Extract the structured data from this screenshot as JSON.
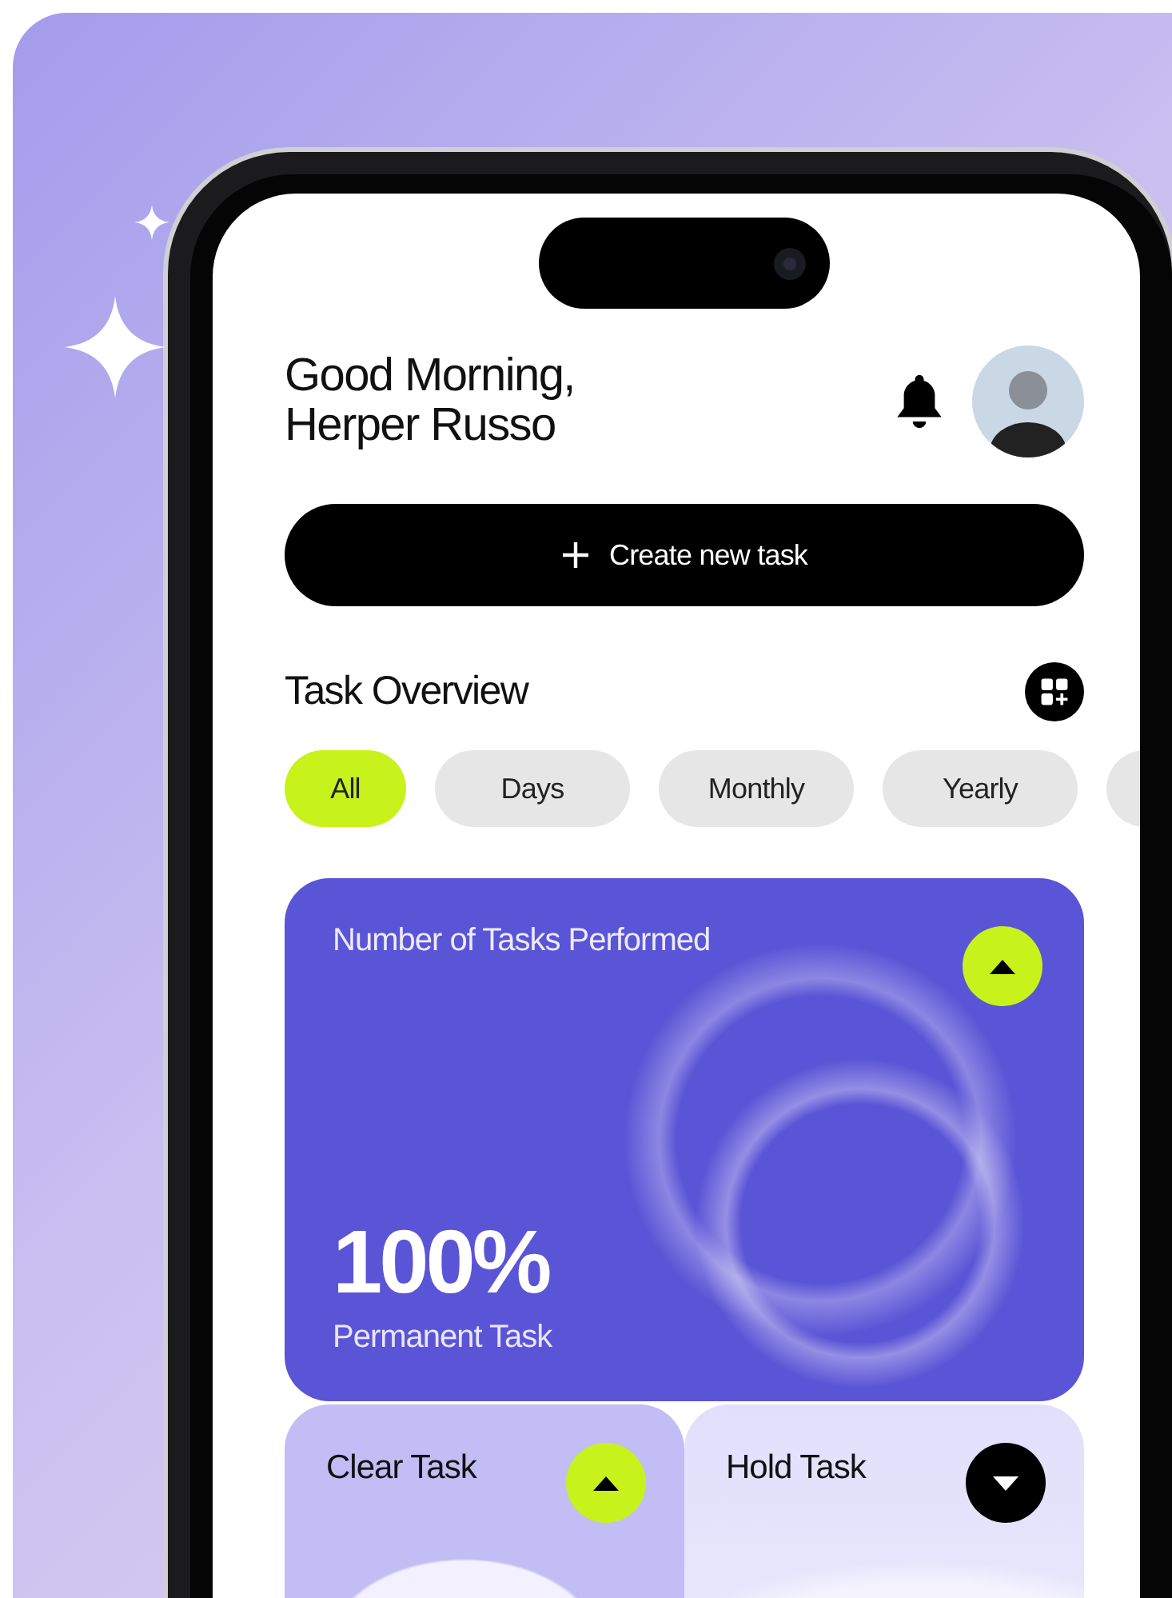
{
  "greeting": {
    "line_1": "Good Morning,",
    "line_2": "Herper Russo"
  },
  "create_button": {
    "label": "Create new task"
  },
  "overview": {
    "title": "Task Overview"
  },
  "filters": [
    {
      "label": "All",
      "selected": true
    },
    {
      "label": "Days",
      "selected": false
    },
    {
      "label": "Monthly",
      "selected": false
    },
    {
      "label": "Yearly",
      "selected": false
    }
  ],
  "summary_card": {
    "title": "Number of Tasks Performed",
    "active": true,
    "value": "100%",
    "caption": "Permanent Task"
  },
  "task_cards": [
    {
      "title": "Clear Task",
      "active": true
    },
    {
      "title": "Hold Task",
      "active": false
    }
  ]
}
